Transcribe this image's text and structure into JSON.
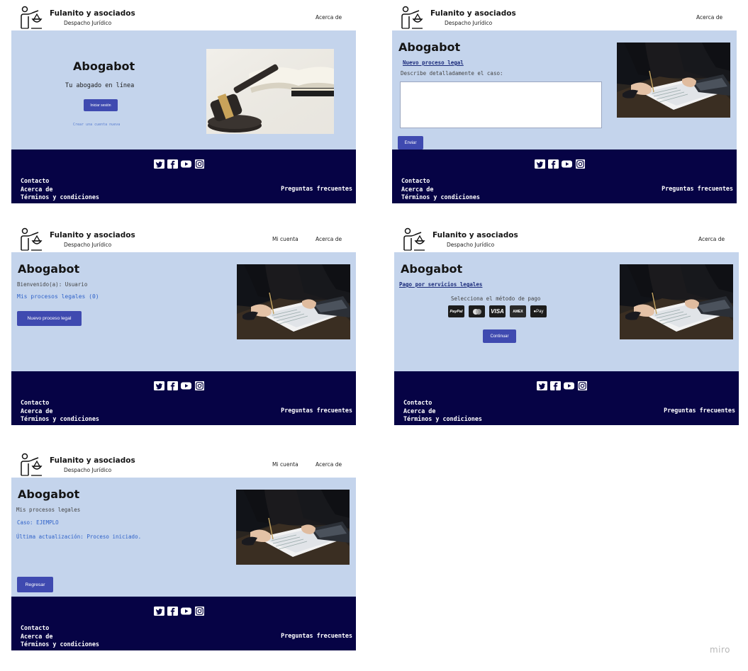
{
  "brand": {
    "name": "Fulanito y asociados",
    "subtitle": "Despacho Jurídico"
  },
  "nav": {
    "about": "Acerca de",
    "account": "Mi cuenta"
  },
  "app_title": "Abogabot",
  "footer": {
    "contact": "Contacto",
    "about": "Acerca de",
    "terms": "Términos y condiciones",
    "faq": "Preguntas frecuentes",
    "social_icons": [
      "twitter-icon",
      "facebook-icon",
      "youtube-icon",
      "instagram-icon"
    ]
  },
  "screens": {
    "login": {
      "tagline": "Tu abogado en línea",
      "login_button": "Iniciar sesión",
      "create_account": "Crear una cuenta nueva"
    },
    "new_case": {
      "section_link": "Nuevo proceso legal",
      "prompt": "Describe detalladamente el caso:",
      "textarea_value": "",
      "send_button": "Enviar"
    },
    "dashboard": {
      "welcome": "Bienvenido(a): Usuario",
      "my_cases_link": "Mis procesos legales (0)",
      "new_case_button": "Nuevo proceso legal"
    },
    "payment": {
      "section_link": "Pago por servicios legales",
      "prompt": "Selecciona el método de pago",
      "methods": [
        "PayPal",
        "Mastercard",
        "VISA",
        "American Express",
        "Apple Pay"
      ],
      "method_labels": [
        "PayPal",
        "",
        "VISA",
        "AMEX",
        "Pay"
      ],
      "continue_button": "Continuar"
    },
    "case_detail": {
      "heading": "Mis procesos legales",
      "case_label": "Caso: EJEMPLO",
      "last_update": "Última actualización: Proceso iniciado.",
      "back_button": "Regresar"
    }
  },
  "colors": {
    "main_bg": "#c4d4ec",
    "footer_bg": "#060345",
    "button": "#3f4ab0",
    "link": "#2f62c9"
  },
  "watermark": "miro"
}
